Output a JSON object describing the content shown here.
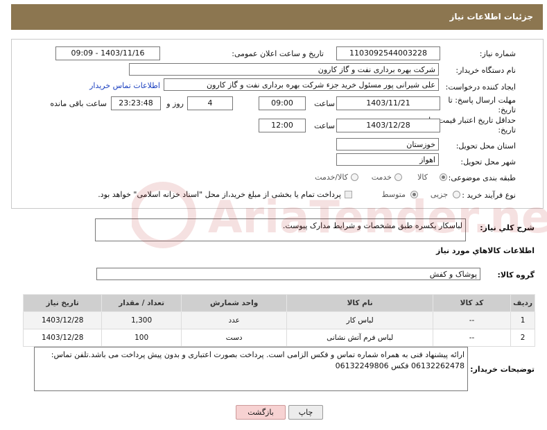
{
  "header": {
    "title": "جزئیات اطلاعات نیاز"
  },
  "form": {
    "need_number_label": "شماره نیاز:",
    "need_number": "1103092544003228",
    "announce_label": "تاریخ و ساعت اعلان عمومی:",
    "announce_value": "1403/11/16 - 09:09",
    "buyer_label": "نام دستگاه خریدار:",
    "buyer_value": "شرکت بهره برداری نفت و گاز کارون",
    "creator_label": "ایجاد کننده درخواست:",
    "creator_value": "علی شیرانی پور مسئول خرید جزء شرکت بهره برداری نفت و گاز کارون",
    "contact_link": "اطلاعات تماس خریدار",
    "reply_label_1": "مهلت ارسال پاسخ: تا",
    "reply_label_2": "تاریخ:",
    "reply_date": "1403/11/21",
    "time_label": "ساعت",
    "reply_time": "09:00",
    "days_value": "4",
    "days_label": "روز و",
    "remain_value": "23:23:48",
    "remain_label": "ساعت باقی مانده",
    "price_label_1": "حداقل تاریخ اعتبار قیمت: تا",
    "price_label_2": "تاریخ:",
    "price_date": "1403/12/28",
    "price_time": "12:00",
    "province_label": "استان محل تحویل:",
    "province_value": "خوزستان",
    "city_label": "شهر محل تحویل:",
    "city_value": "اهواز",
    "category_label": "طبقه بندی موضوعی:",
    "cat_goods": "کالا",
    "cat_service": "خدمت",
    "cat_both": "کالا/خدمت",
    "process_label": "نوع فرآیند خرید :",
    "proc_partial": "جزیی",
    "proc_medium": "متوسط",
    "proc_note": "پرداخت تمام یا بخشی از مبلغ خرید،از محل \"اسناد خزانه اسلامی\" خواهد بود."
  },
  "description": {
    "label": "شرح کلي نياز:",
    "text": "لباسکار یکسره طبق مشخصات و شرایط مدارک پیوست."
  },
  "goods": {
    "section_title": "اطلاعات کالاهاي مورد نياز",
    "group_label": "گروه کالا:",
    "group_value": "پوشاک و کفش",
    "columns": [
      "رديف",
      "کد کالا",
      "نام کالا",
      "واحد شمارش",
      "تعداد / مقدار",
      "تاریخ نیاز"
    ],
    "rows": [
      {
        "idx": "1",
        "code": "--",
        "name": "لباس کار",
        "unit": "عدد",
        "qty": "1,300",
        "date": "1403/12/28"
      },
      {
        "idx": "2",
        "code": "--",
        "name": "لباس فرم آتش نشانی",
        "unit": "دست",
        "qty": "100",
        "date": "1403/12/28"
      }
    ]
  },
  "buyer_notes": {
    "label": "توضیحات خریدار:",
    "text": "ارائه پیشنهاد فنی به همراه شماره تماس و فکس الزامی است. پرداخت بصورت اعتباری و بدون پیش پرداخت می باشد.تلفن تماس: 06132262478 فکس 06132249806"
  },
  "buttons": {
    "print": "چاپ",
    "back": "بازگشت"
  },
  "watermark": {
    "text": "AriaTender.net"
  }
}
